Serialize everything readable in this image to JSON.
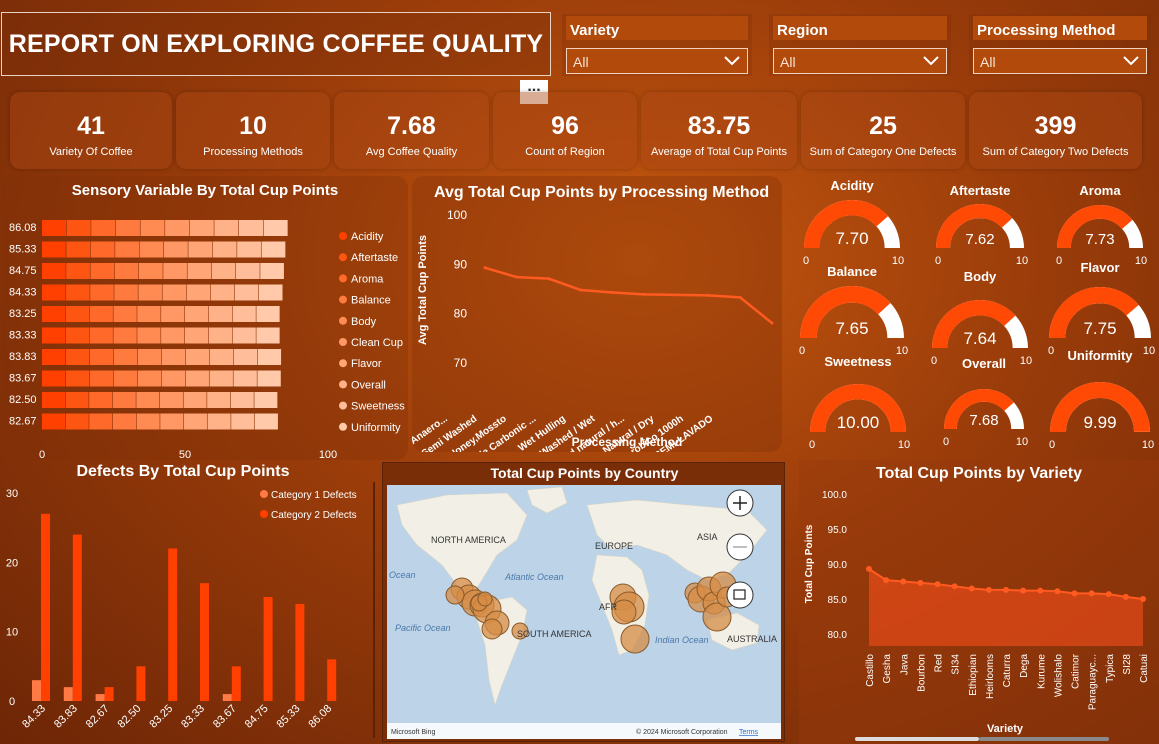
{
  "title": "REPORT ON EXPLORING COFFEE QUALITY",
  "slicers": [
    {
      "label": "Variety",
      "value": "All"
    },
    {
      "label": "Region",
      "value": "All"
    },
    {
      "label": "Processing Method",
      "value": "All"
    }
  ],
  "kpis": [
    {
      "value": "41",
      "label": "Variety Of Coffee"
    },
    {
      "value": "10",
      "label": "Processing Methods"
    },
    {
      "value": "7.68",
      "label": "Avg Coffee Quality"
    },
    {
      "value": "96",
      "label": "Count of Region"
    },
    {
      "value": "83.75",
      "label": "Average of Total Cup Points"
    },
    {
      "value": "25",
      "label": "Sum of Category One Defects"
    },
    {
      "value": "399",
      "label": "Sum of Category Two Defects"
    }
  ],
  "colors": {
    "accent": "#ff4a05",
    "light": "#ffb08c",
    "track": "#ffffff",
    "background": "#9a3c0a"
  },
  "sensory": {
    "title": "Sensory Variable By Total Cup Points",
    "categories": [
      "86.08",
      "85.33",
      "84.75",
      "84.33",
      "83.25",
      "83.33",
      "83.83",
      "83.67",
      "82.50",
      "82.67"
    ],
    "legend": [
      "Acidity",
      "Aftertaste",
      "Aroma",
      "Balance",
      "Body",
      "Clean Cup",
      "Flavor",
      "Overall",
      "Sweetness",
      "Uniformity"
    ],
    "xticks": [
      "0",
      "50",
      "100"
    ],
    "chart_data": {
      "type": "bar",
      "orientation": "horizontal-stacked",
      "categories": [
        "86.08",
        "85.33",
        "84.75",
        "84.33",
        "83.25",
        "83.33",
        "83.83",
        "83.67",
        "82.50",
        "82.67"
      ],
      "series_names": [
        "Acidity",
        "Aftertaste",
        "Aroma",
        "Balance",
        "Body",
        "Clean Cup",
        "Flavor",
        "Overall",
        "Sweetness",
        "Uniformity"
      ],
      "totals": [
        86.1,
        85.3,
        84.8,
        84.3,
        83.3,
        83.3,
        83.8,
        83.7,
        82.5,
        82.7
      ],
      "xlim": [
        0,
        100
      ]
    }
  },
  "line": {
    "title": "Avg Total Cup Points by Processing Method",
    "xlabel": "Processing Method",
    "ylabel": "Avg Total Cup Points",
    "yticks": [
      "100",
      "90",
      "80",
      "70"
    ],
    "chart_data": {
      "type": "line",
      "categories": [
        "Double Anaero...",
        "Semi Washed",
        "Honey,Mossto",
        "Double Carbonic ...",
        "Wet Hulling",
        "Washed / Wet",
        "Pulped natural / h...",
        "Natural / Dry",
        "Anaerobico 1000h",
        "SEMI-LAVADO"
      ],
      "values": [
        89.3,
        87.4,
        87.1,
        84.8,
        84.3,
        83.9,
        83.8,
        83.7,
        83.3,
        78.1
      ],
      "ylim": [
        70,
        100
      ]
    }
  },
  "gauges": [
    {
      "name": "Acidity",
      "value": "7.70",
      "min": "0",
      "max": "10"
    },
    {
      "name": "Aftertaste",
      "value": "7.62",
      "min": "0",
      "max": "10"
    },
    {
      "name": "Aroma",
      "value": "7.73",
      "min": "0",
      "max": "10"
    },
    {
      "name": "Balance",
      "value": "7.65",
      "min": "0",
      "max": "10"
    },
    {
      "name": "Body",
      "value": "7.64",
      "min": "0",
      "max": "10"
    },
    {
      "name": "Flavor",
      "value": "7.75",
      "min": "0",
      "max": "10"
    },
    {
      "name": "Sweetness",
      "value": "10.00",
      "min": "0",
      "max": "10"
    },
    {
      "name": "Overall",
      "value": "7.68",
      "min": "0",
      "max": "10"
    },
    {
      "name": "Uniformity",
      "value": "9.99",
      "min": "0",
      "max": "10"
    }
  ],
  "defects": {
    "title": "Defects By Total Cup Points",
    "legend": [
      "Category 1 Defects",
      "Category 2 Defects"
    ],
    "yticks": [
      "30",
      "20",
      "10",
      "0"
    ],
    "chart_data": {
      "type": "bar",
      "categories": [
        "84.33",
        "83.83",
        "82.67",
        "82.50",
        "83.25",
        "83.33",
        "83.67",
        "84.75",
        "85.33",
        "86.08"
      ],
      "series": [
        {
          "name": "Category 1 Defects",
          "values": [
            3,
            2,
            1,
            0,
            0,
            0,
            1,
            0,
            0,
            0
          ]
        },
        {
          "name": "Category 2 Defects",
          "values": [
            27,
            24,
            2,
            5,
            22,
            17,
            5,
            15,
            14,
            6
          ]
        }
      ],
      "ylim": [
        0,
        30
      ]
    }
  },
  "map": {
    "title": "Total Cup Points by Country",
    "labels": [
      "NORTH AMERICA",
      "EUROPE",
      "ASIA",
      "Atlantic Ocean",
      "Ocean",
      "Pacific Ocean",
      "SOUTH AMERICA",
      "AFR",
      "Indian Ocean",
      "AUSTRALIA"
    ],
    "attribution": "© 2024 Microsoft Corporation",
    "terms": "Terms",
    "brand": "Microsoft Bing",
    "controls": [
      "zoom-in",
      "zoom-out",
      "select"
    ]
  },
  "variety": {
    "title": "Total Cup Points by Variety",
    "xlabel": "Variety",
    "ylabel": "Total Cup Points",
    "yticks": [
      "100.0",
      "95.0",
      "90.0",
      "85.0",
      "80.0"
    ],
    "chart_data": {
      "type": "area",
      "categories": [
        "Castillo",
        "Gesha",
        "Java",
        "Bourbon",
        "Red",
        "SI34",
        "Ethiopian",
        "Heirlooms",
        "Caturra",
        "Dega",
        "Kurume",
        "Wolishalo",
        "Catimor",
        "Paraguayc...",
        "Typica",
        "SI28",
        "Catuai"
      ],
      "values": [
        89.3,
        87.7,
        87.5,
        87.3,
        87.1,
        86.8,
        86.5,
        86.3,
        86.3,
        86.2,
        86.2,
        86.1,
        85.8,
        85.8,
        85.7,
        85.3,
        85.0
      ],
      "ylim": [
        80,
        100
      ]
    }
  }
}
